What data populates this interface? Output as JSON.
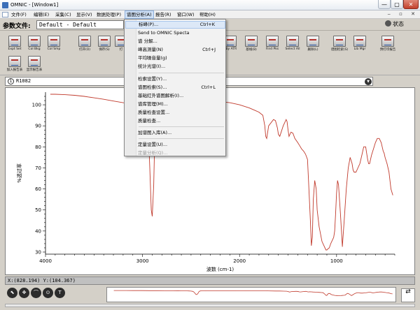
{
  "window": {
    "title": "OMNIC - [Window1]",
    "controls": {
      "minimize": "—",
      "maximize": "▢",
      "close": "✕"
    }
  },
  "menubar": {
    "items": [
      "文件(F)",
      "编辑(E)",
      "采集(C)",
      "显示(V)",
      "数据处理(P)",
      "谱图分析(A)",
      "报告(R)",
      "窗口(W)",
      "帮助(H)"
    ],
    "active_index": 5,
    "mdi_controls": "‒ ▫ ✕"
  },
  "param_bar": {
    "label": "参数文件:",
    "value": "Default - Default",
    "status_label": "状态"
  },
  "toolbar": {
    "row1": [
      {
        "label": "Expt Set",
        "icon": "experiment-setup-icon"
      },
      {
        "label": "Col Bkg",
        "icon": "collect-background-icon"
      },
      {
        "label": "Col Smp",
        "icon": "collect-sample-icon"
      },
      {
        "label": "打开(O)",
        "icon": "open-icon"
      },
      {
        "label": "保存(S)",
        "icon": "save-icon"
      },
      {
        "label": "打",
        "icon": "print-icon"
      },
      {
        "label": "Sby ATR",
        "icon": "atr-icon"
      },
      {
        "label": "基线(B)",
        "icon": "baseline-icon"
      },
      {
        "label": "Find Pks",
        "icon": "find-peaks-icon"
      },
      {
        "label": "Select All",
        "icon": "select-all-icon"
      },
      {
        "label": "删除(L)",
        "icon": "delete-icon"
      },
      {
        "label": "谱图检索(S)",
        "icon": "spectral-search-icon"
      },
      {
        "label": "Lib Mgr",
        "icon": "library-manager-icon"
      },
      {
        "label": "预打印报告",
        "icon": "print-report-icon"
      }
    ],
    "row2": [
      {
        "label": "加入报告表",
        "icon": "add-to-report-icon"
      },
      {
        "label": "显示报告表",
        "icon": "show-report-icon"
      }
    ]
  },
  "dropdown": {
    "items": [
      {
        "label": "标峰(P)...",
        "shortcut": "Ctrl+K",
        "highlighted": true,
        "disabled": false
      },
      {
        "label": "Send to OMNIC Specta",
        "shortcut": "",
        "highlighted": false,
        "disabled": false
      },
      {
        "label": "谱 分解...",
        "shortcut": "",
        "highlighted": false,
        "disabled": false
      },
      {
        "label": "峰高测量(N)",
        "shortcut": "Ctrl+J",
        "highlighted": false,
        "disabled": false
      },
      {
        "label": "平均噪音量(g)",
        "shortcut": "",
        "highlighted": false,
        "disabled": false
      },
      {
        "label": "统计光谱(I)...",
        "shortcut": "",
        "highlighted": false,
        "disabled": false
      },
      {
        "label": "检索设置(Y)...",
        "shortcut": "",
        "highlighted": false,
        "disabled": false
      },
      {
        "label": "谱图检索(S)...",
        "shortcut": "Ctrl+L",
        "highlighted": false,
        "disabled": false
      },
      {
        "label": "基础红外谱图解析(I)...",
        "shortcut": "",
        "highlighted": false,
        "disabled": false
      },
      {
        "label": "谱库管理(M)...",
        "shortcut": "",
        "highlighted": false,
        "disabled": false
      },
      {
        "label": "质量检查设置...",
        "shortcut": "",
        "highlighted": false,
        "disabled": false
      },
      {
        "label": "质量检查...",
        "shortcut": "",
        "highlighted": false,
        "disabled": false
      },
      {
        "label": "加谱图入库(A)...",
        "shortcut": "",
        "highlighted": false,
        "disabled": false
      },
      {
        "label": "定量设置(U)...",
        "shortcut": "",
        "highlighted": false,
        "disabled": false
      },
      {
        "label": "定量分析(Q)...",
        "shortcut": "",
        "highlighted": false,
        "disabled": true
      }
    ]
  },
  "spectrum_window": {
    "title": "R1082",
    "number_icon": "1",
    "dropdown_icon": "▼"
  },
  "coords": {
    "text": "X:(828.194) Y:(104.367)"
  },
  "bottom_tools": [
    "⬉",
    "✥",
    "⌒",
    "⊙",
    "T"
  ],
  "nav_arrows": "⇄",
  "colors": {
    "trace": "#c0392b",
    "window_bg": "#d4d0c8",
    "menu_highlight": "#dce8f7"
  },
  "chart_data": {
    "type": "line",
    "title": "",
    "xlabel": "波数 (cm-1)",
    "ylabel": "%透过率",
    "xlim": [
      4000,
      400
    ],
    "ylim": [
      29,
      106
    ],
    "x_reversed": true,
    "xticks": [
      4000,
      3000,
      2000,
      1000
    ],
    "yticks": [
      30,
      40,
      50,
      60,
      70,
      80,
      90,
      100
    ],
    "grid": false,
    "series": [
      {
        "x": [
          3950,
          3900,
          3800,
          3700,
          3600,
          3500,
          3400,
          3300,
          3200,
          3100,
          3020,
          3000,
          2975,
          2955,
          2940,
          2925,
          2910,
          2900,
          2885,
          2870,
          2855,
          2840,
          2800,
          2700,
          2600,
          2500,
          2400,
          2300,
          2200,
          2100,
          2000,
          1900,
          1850,
          1800,
          1760,
          1740,
          1730,
          1720,
          1700,
          1650,
          1630,
          1610,
          1600,
          1585,
          1550,
          1520,
          1510,
          1500,
          1490,
          1470,
          1450,
          1430,
          1400,
          1380,
          1360,
          1340,
          1320,
          1300,
          1290,
          1270,
          1260,
          1250,
          1240,
          1225,
          1210,
          1200,
          1180,
          1150,
          1130,
          1110,
          1100,
          1090,
          1075,
          1060,
          1040,
          1030,
          1020,
          1010,
          1000,
          990,
          980,
          970,
          960,
          950,
          940,
          920,
          900,
          880,
          860,
          840,
          830,
          820,
          800,
          780,
          760,
          740,
          720,
          700,
          690,
          680,
          670,
          660,
          640,
          620,
          600,
          580,
          560,
          540,
          530,
          520,
          510,
          500,
          480,
          460,
          440,
          420
        ],
        "y": [
          105,
          105,
          104.8,
          104.5,
          104,
          103.3,
          102.6,
          101.8,
          101,
          100.4,
          99.8,
          99,
          97,
          94,
          88,
          70,
          50,
          47,
          62,
          92,
          99,
          100,
          100.3,
          100.7,
          101,
          101.3,
          101.6,
          101.7,
          101.5,
          101,
          100,
          98.5,
          97.5,
          96.5,
          95,
          90,
          85,
          84,
          90,
          93,
          92.5,
          89,
          86,
          85,
          90,
          93,
          92,
          88,
          85,
          87,
          86.5,
          84,
          82,
          80.5,
          79,
          78,
          76.5,
          74,
          65,
          45,
          33,
          37,
          55,
          64,
          60,
          50,
          42,
          35,
          33,
          31,
          31,
          31.5,
          32,
          34,
          36,
          37,
          40,
          48,
          58,
          64,
          62,
          55,
          48,
          40,
          32.5,
          46,
          60,
          70,
          75,
          72,
          69,
          68,
          68,
          70,
          72,
          76,
          80,
          80,
          77,
          74,
          72,
          72,
          76,
          79,
          82,
          84,
          84,
          82,
          80,
          78,
          77,
          75,
          72,
          68,
          60,
          57
        ]
      }
    ]
  }
}
